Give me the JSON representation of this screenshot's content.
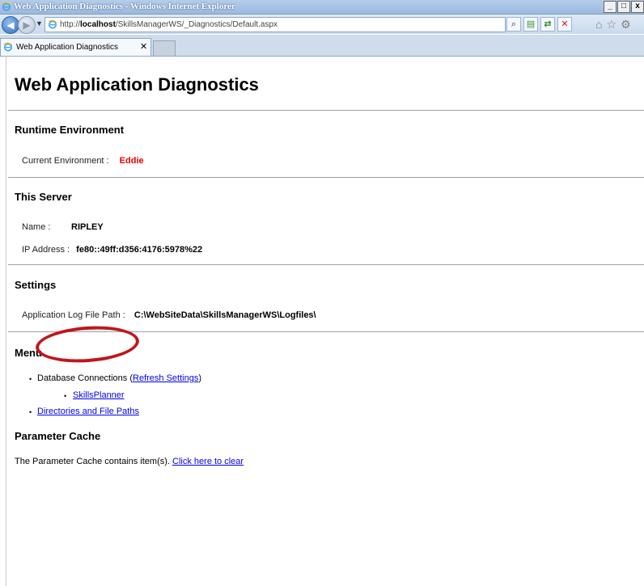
{
  "window": {
    "title": "Web Application Diagnostics - Windows Internet Explorer",
    "min_glyph": "_",
    "max_glyph": "□",
    "close_glyph": "x"
  },
  "nav": {
    "url_prefix": "http://",
    "url_host": "localhost",
    "url_path": "/SkillsManagerWS/_Diagnostics/Default.aspx"
  },
  "tab": {
    "label": "Web Application Diagnostics",
    "close_glyph": "✕"
  },
  "page": {
    "title": "Web Application Diagnostics",
    "runtime": {
      "heading": "Runtime Environment",
      "label": "Current Environment :",
      "value": "Eddie"
    },
    "server": {
      "heading": "This Server",
      "name_label": "Name :",
      "name_value": "RIPLEY",
      "ip_label": "IP Address :",
      "ip_value": "fe80::49ff:d356:4176:5978%22"
    },
    "settings": {
      "heading": "Settings",
      "log_label": "Application Log File Path :",
      "log_value": "C:\\WebSiteData\\SkillsManagerWS\\Logfiles\\"
    },
    "menu": {
      "heading": "Menu",
      "db_text": "Database Connections (",
      "refresh_link": "Refresh Settings",
      "db_close": ")",
      "skills_planner_link": "SkillsPlanner",
      "dirs_link": "Directories and File Paths"
    },
    "cache": {
      "heading": "Parameter Cache",
      "text": "The Parameter Cache contains item(s).",
      "clear_link": "Click here to clear"
    }
  },
  "colors": {
    "environment_value": "#e60000",
    "link": "#0000ee",
    "annotation_circle": "#c0161c"
  }
}
